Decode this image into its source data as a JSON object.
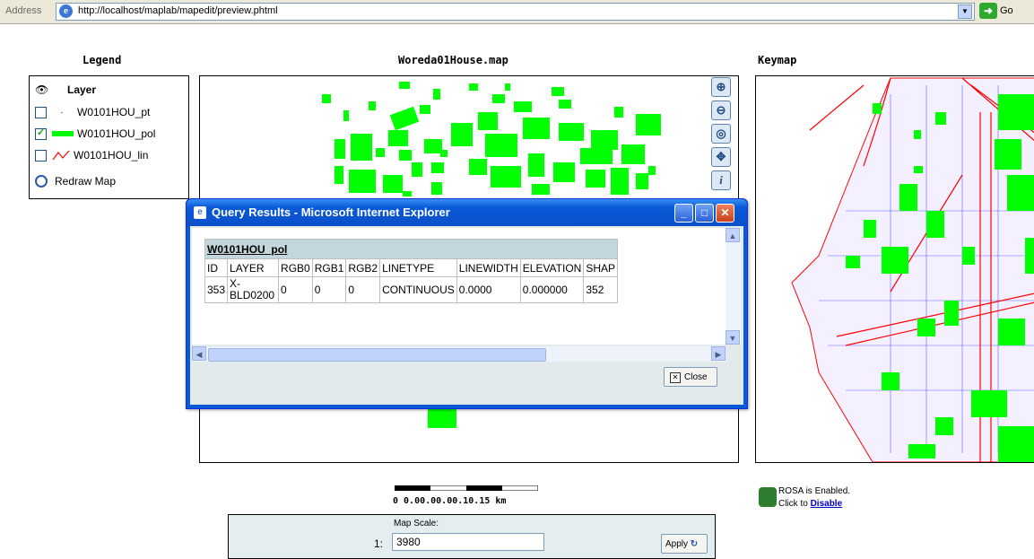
{
  "address_bar": {
    "label": "Address",
    "url": "http://localhost/maplab/mapedit/preview.phtml",
    "go_label": "Go"
  },
  "legend": {
    "title": "Legend",
    "header": "Layer",
    "items": [
      {
        "label": "W0101HOU_pt",
        "checked": false,
        "swatch": "point"
      },
      {
        "label": "W0101HOU_pol",
        "checked": true,
        "swatch": "polygon",
        "color": "#00ff00"
      },
      {
        "label": "W0101HOU_lin",
        "checked": false,
        "swatch": "line",
        "color": "#ff0000"
      }
    ],
    "redraw_label": "Redraw Map"
  },
  "map": {
    "title": "Woreda01House.map",
    "tools": [
      "zoom-in-icon",
      "zoom-out-icon",
      "zoom-full-icon",
      "pan-icon",
      "info-icon"
    ],
    "feature_color": "#00ff00"
  },
  "keymap": {
    "title": "Keymap",
    "line_color": "#ff0000",
    "feature_color": "#00ff00",
    "street_color": "#0000ff"
  },
  "scalebar": {
    "label": "0 0.00.00.00.10.15 km"
  },
  "map_scale": {
    "label": "Map Scale:",
    "prefix": "1:",
    "value": "3980",
    "apply_label": "Apply"
  },
  "rosa": {
    "line1": "ROSA is Enabled.",
    "line2_prefix": "Click to",
    "link": "Disable"
  },
  "popup": {
    "title": "Query Results - Microsoft Internet Explorer",
    "layer_name": "W0101HOU_pol",
    "columns": [
      "ID",
      "LAYER",
      "RGB0",
      "RGB1",
      "RGB2",
      "LINETYPE",
      "LINEWIDTH",
      "ELEVATION",
      "SHAP"
    ],
    "row": [
      "353",
      "X-BLD0200",
      "0",
      "0",
      "0",
      "CONTINUOUS",
      "0.0000",
      "0.000000",
      "352"
    ],
    "close_label": "Close"
  }
}
